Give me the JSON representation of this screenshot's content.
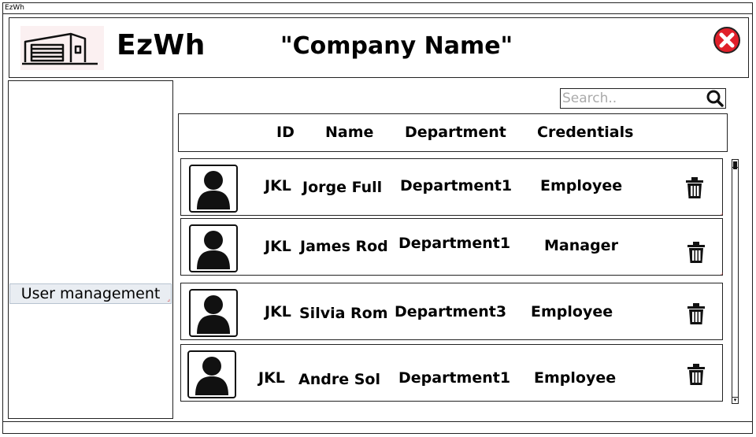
{
  "window": {
    "title": "EzWh"
  },
  "header": {
    "app_name": "EzWh",
    "company_name": "\"Company Name\""
  },
  "sidebar": {
    "items": [
      {
        "label": "User management"
      }
    ]
  },
  "search": {
    "placeholder": "Search.."
  },
  "table": {
    "columns": [
      "ID",
      "Name",
      "Department",
      "Credentials"
    ],
    "rows": [
      {
        "id": "JKL",
        "name": "Jorge Full",
        "department": "Department1",
        "credentials": "Employee"
      },
      {
        "id": "JKL",
        "name": "James Rod",
        "department": "Department1",
        "credentials": "Manager"
      },
      {
        "id": "JKL",
        "name": "Silvia Rom",
        "department": "Department3",
        "credentials": "Employee"
      },
      {
        "id": "JKL",
        "name": "Andre Sol",
        "department": "Department1",
        "credentials": "Employee"
      }
    ]
  },
  "icons": {
    "close": "close-icon",
    "search": "search-icon",
    "delete": "trash-icon",
    "avatar": "user-avatar-icon",
    "logo": "warehouse-logo"
  },
  "colors": {
    "close_red": "#e0202a",
    "sidebar_selected": "#e9edf2"
  }
}
